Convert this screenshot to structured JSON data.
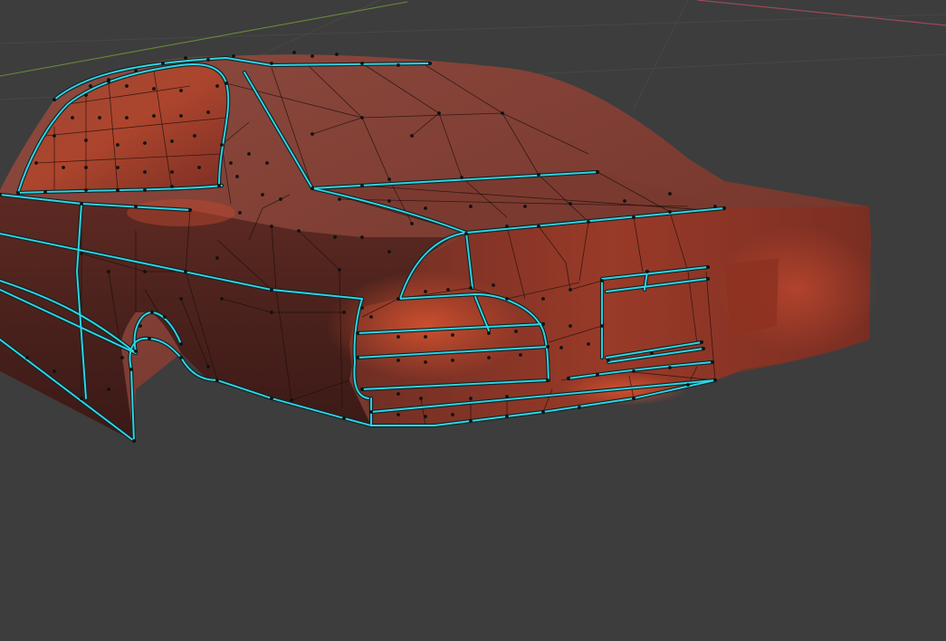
{
  "viewport": {
    "background_color": "#3d3d3d",
    "grid_color": "#474747",
    "x_axis_color": "#9b4a56",
    "y_axis_color": "#6a8a3a"
  },
  "mesh": {
    "object": "car-body",
    "material_color": "#8a3426",
    "material_highlight": "#c84a32",
    "material_shadow": "#3a1a16",
    "wire_color": "#1a0d0a",
    "seam_color": "#2fd6e6",
    "vertex_color": "#111111"
  }
}
